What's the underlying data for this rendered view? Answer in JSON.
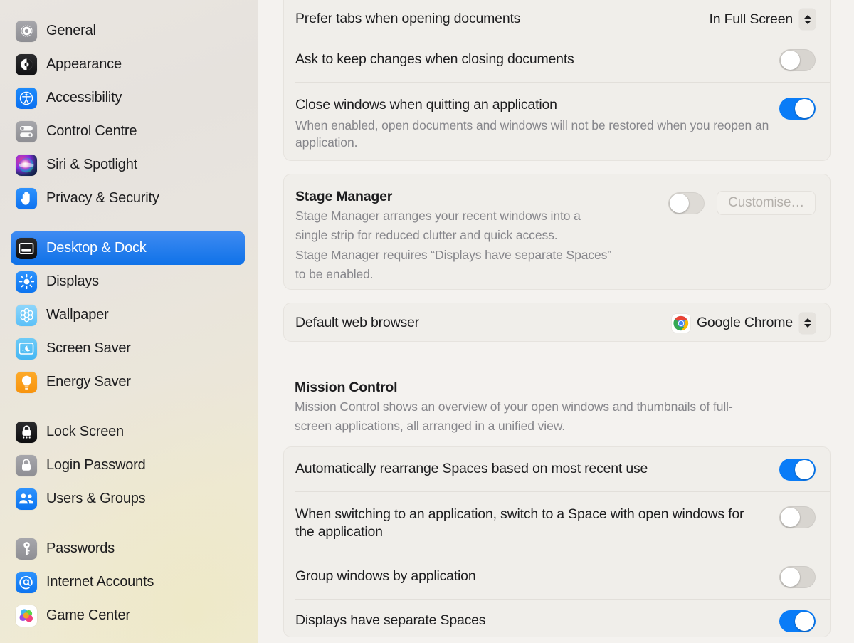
{
  "sidebar": {
    "groups": [
      {
        "items": [
          {
            "label": "General",
            "icon": "gear-icon"
          },
          {
            "label": "Appearance",
            "icon": "appearance-icon"
          },
          {
            "label": "Accessibility",
            "icon": "accessibility-icon"
          },
          {
            "label": "Control Centre",
            "icon": "control-centre-icon"
          },
          {
            "label": "Siri & Spotlight",
            "icon": "siri-icon"
          },
          {
            "label": "Privacy & Security",
            "icon": "privacy-hand-icon"
          }
        ]
      },
      {
        "items": [
          {
            "label": "Desktop & Dock",
            "icon": "desktop-dock-icon",
            "selected": true
          },
          {
            "label": "Displays",
            "icon": "displays-icon"
          },
          {
            "label": "Wallpaper",
            "icon": "wallpaper-icon"
          },
          {
            "label": "Screen Saver",
            "icon": "screen-saver-icon"
          },
          {
            "label": "Energy Saver",
            "icon": "energy-saver-icon"
          }
        ]
      },
      {
        "items": [
          {
            "label": "Lock Screen",
            "icon": "lock-screen-icon"
          },
          {
            "label": "Login Password",
            "icon": "login-password-icon"
          },
          {
            "label": "Users & Groups",
            "icon": "users-groups-icon"
          }
        ]
      },
      {
        "items": [
          {
            "label": "Passwords",
            "icon": "key-icon"
          },
          {
            "label": "Internet Accounts",
            "icon": "at-sign-icon"
          },
          {
            "label": "Game Center",
            "icon": "game-center-icon"
          }
        ]
      }
    ]
  },
  "main": {
    "windows_card": {
      "prefer_tabs": {
        "label": "Prefer tabs when opening documents",
        "value": "In Full Screen"
      },
      "ask_keep_changes": {
        "label": "Ask to keep changes when closing documents",
        "state": "off"
      },
      "close_windows": {
        "label": "Close windows when quitting an application",
        "state": "on",
        "description": "When enabled, open documents and windows will not be restored when you reopen an application."
      }
    },
    "stage_manager": {
      "title": "Stage Manager",
      "state": "off",
      "customise_label": "Customise…",
      "description_lines": [
        "Stage Manager arranges your recent windows into a",
        "single strip for reduced clutter and quick access.",
        "Stage Manager requires “Displays have separate Spaces”",
        "to be enabled."
      ]
    },
    "default_browser": {
      "label": "Default web browser",
      "value": "Google Chrome",
      "icon": "chrome-icon"
    },
    "mission_control": {
      "title": "Mission Control",
      "description_lines": [
        "Mission Control shows an overview of your open windows and thumbnails of full-",
        "screen applications, all arranged in a unified view."
      ],
      "rows": [
        {
          "label": "Automatically rearrange Spaces based on most recent use",
          "state": "on"
        },
        {
          "label": "When switching to an application, switch to a Space with open windows for the application",
          "state": "off"
        },
        {
          "label": "Group windows by application",
          "state": "off"
        },
        {
          "label": "Displays have separate Spaces",
          "state": "on"
        }
      ]
    }
  },
  "colors": {
    "accent": "#0a7cf7",
    "selected_sidebar": "#1072e8",
    "card_bg": "#f0eeea",
    "panel_bg": "#f4f2ef",
    "secondary_text": "#86868b"
  }
}
